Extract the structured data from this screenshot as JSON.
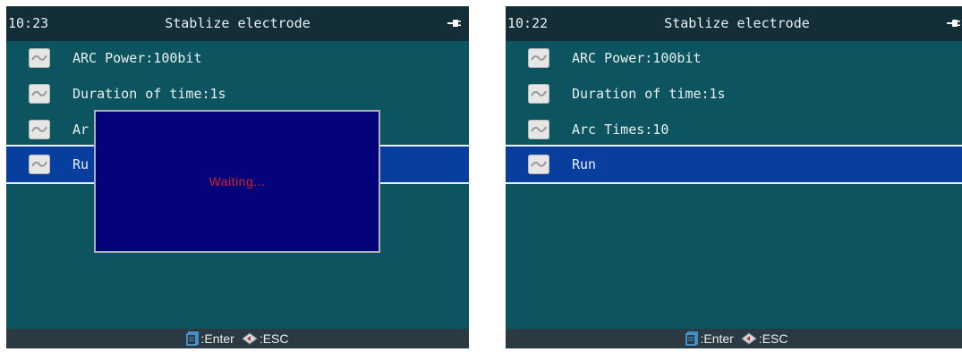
{
  "left_screen": {
    "time": "10:23",
    "title": "Stablize electrode",
    "items": [
      {
        "label": "ARC Power:100bit"
      },
      {
        "label": "Duration of time:1s"
      },
      {
        "label": "Ar"
      },
      {
        "label": "Ru"
      }
    ],
    "popup": {
      "message": "Waiting..."
    },
    "status": {
      "enter_label": ":Enter",
      "esc_label": ":ESC"
    }
  },
  "right_screen": {
    "time": "10:22",
    "title": "Stablize electrode",
    "items": [
      {
        "label": "ARC Power:100bit"
      },
      {
        "label": "Duration of time:1s"
      },
      {
        "label": "Arc Times:10"
      },
      {
        "label": "Run"
      }
    ],
    "status": {
      "enter_label": ":Enter",
      "esc_label": ":ESC"
    }
  },
  "colors": {
    "background": "#0c5560",
    "title_bar": "#132e36",
    "selection": "#083e9e",
    "popup": "#05037a",
    "popup_text": "#d0202a",
    "status_bar": "#2b3a42"
  },
  "icons": [
    "plug-icon",
    "item-icon",
    "enter-icon",
    "esc-diamond-icon"
  ]
}
